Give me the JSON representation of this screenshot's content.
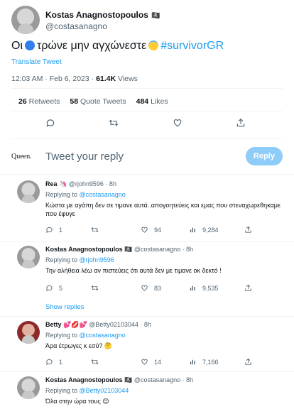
{
  "tweet": {
    "author_name": "Kostas Anagnostopoulos",
    "author_handle": "@costasanagno",
    "text_before": "Οι",
    "text_middle": "τρώνε μην αγχώνεστε",
    "hashtag": "#survivorGR",
    "translate_label": "Translate Tweet",
    "time": "12:03 AM · Feb 6, 2023 ·",
    "views_count": "61.4K",
    "views_label": "Views",
    "retweets_count": "26",
    "retweets_label": "Retweets",
    "quotes_count": "58",
    "quotes_label": "Quote Tweets",
    "likes_count": "484",
    "likes_label": "Likes"
  },
  "compose": {
    "avatar_text": "Queen.",
    "placeholder": "Tweet your reply",
    "button_label": "Reply"
  },
  "replies": [
    {
      "name": "Rea",
      "handle": "@rjohn9596 · 8h",
      "replying_prefix": "Replying to",
      "replying_to": "@costasanagno",
      "text": "Κώστα με αγάπη δεν σε τιμανε αυτά..απογοητεύεις και εμας που στεναχωρεθηκαμε που έφυγε",
      "replies": "1",
      "retweets": "",
      "likes": "94",
      "views": "9,284"
    },
    {
      "name": "Kostas Anagnostopoulos",
      "handle": "@costasanagno · 8h",
      "replying_prefix": "Replying to",
      "replying_to": "@rjohn9596",
      "text": "Την αλήθεια λέω αν πιστεύεις ότι αυτά δεν με τιμανε οκ δεκτό !",
      "replies": "5",
      "retweets": "",
      "likes": "83",
      "views": "9,535"
    },
    {
      "name": "Betty",
      "handle": "@Betty02103044 · 8h",
      "replying_prefix": "Replying to",
      "replying_to": "@costasanagno",
      "text": "Άρα έτρωγες κ εσύ?",
      "replies": "1",
      "retweets": "",
      "likes": "14",
      "views": "7,166"
    },
    {
      "name": "Kostas Anagnostopoulos",
      "handle": "@costasanagno · 8h",
      "replying_prefix": "Replying to",
      "replying_to": "@Betty02103044",
      "text": "Όλα στην ώρα τους"
    }
  ],
  "show_replies_label": "Show replies",
  "colors": {
    "accent": "#1d9bf0",
    "muted": "#536471",
    "reply_button": "#8ecdf8"
  }
}
